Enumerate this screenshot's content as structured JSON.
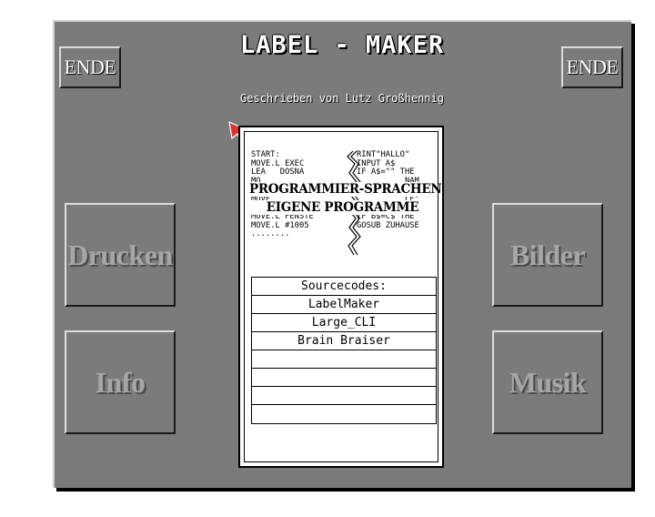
{
  "title": "LABEL - MAKER",
  "subtitle": "Geschrieben von Lutz Großhennig",
  "buttons": {
    "ende_left": "ENDE",
    "ende_right": "ENDE",
    "drucken": "Drucken",
    "info": "Info",
    "bilder": "Bilder",
    "musik": "Musik"
  },
  "logo": {
    "code_left": "START:\nMOVE.L EXEC\nLEA   DOSNA\nMO\nJSR\nMOVE\nBEQ   ERROR\nMOVE.L FENSTE\nMOVE.L #1005\n........",
    "code_right": "RINT\"HALLO\"\nINPUT A$\nIF A$=\"\" THE\n          NAM\n\n          LE\"\n C$=\"DOOF\"\nIF B$=C$ THE\nGOSUB ZUHAUSE",
    "stamp_line1": "PROGRAMMIER-SPRACHEN",
    "stamp_line2": "EIGENE PROGRAMME"
  },
  "sourcecodes": {
    "header": "Sourcecodes:",
    "items": [
      "LabelMaker",
      "Large_CLI",
      "Brain Braiser",
      "",
      "",
      "",
      ""
    ]
  },
  "colors": {
    "background": "#7b7b7b",
    "disabled_text": "#a6a6a6",
    "cursor": "#e03030"
  },
  "icons": {
    "cursor": "mouse-pointer-icon"
  }
}
